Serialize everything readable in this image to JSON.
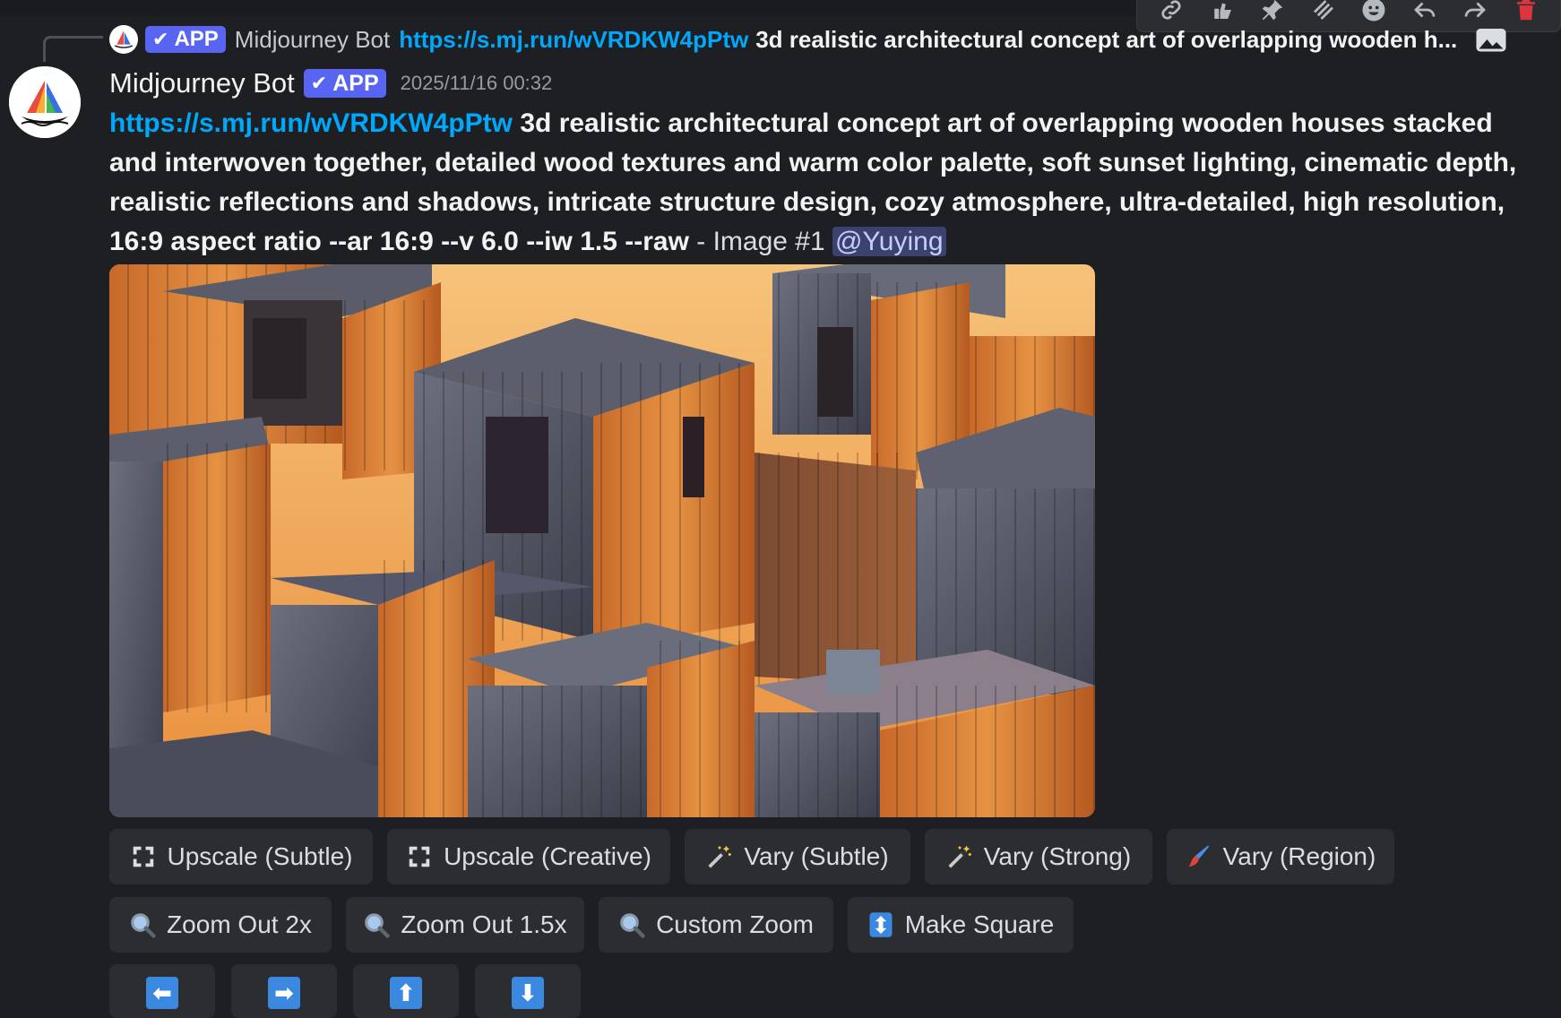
{
  "reply": {
    "badge": "APP",
    "author": "Midjourney Bot",
    "link": "https://s.mj.run/wVRDKW4pPtw",
    "text": "3d realistic architectural concept art of overlapping wooden h..."
  },
  "message": {
    "author": "Midjourney Bot",
    "badge": "APP",
    "timestamp": "2025/11/16 00:32",
    "link": "https://s.mj.run/wVRDKW4pPtw",
    "prompt": "3d realistic architectural concept art of overlapping wooden houses stacked and interwoven together, detailed wood textures and warm color palette, soft sunset lighting, cinematic depth, realistic reflections and shadows, intricate structure design, cozy atmosphere, ultra-detailed, high resolution, 16:9 aspect ratio --ar 16:9 --v 6.0 --iw 1.5 --raw",
    "suffix": " - Image #1 ",
    "mention": "@Yuying"
  },
  "toolbar_icons": [
    "link-icon",
    "react-icon",
    "pin-icon",
    "thread-icon",
    "emoji-icon",
    "reply-icon",
    "forward-icon",
    "delete-icon"
  ],
  "buttons_row1": [
    {
      "label": "Upscale (Subtle)",
      "icon": "expand-icon"
    },
    {
      "label": "Upscale (Creative)",
      "icon": "expand-icon"
    },
    {
      "label": "Vary (Subtle)",
      "icon": "magic-wand-icon"
    },
    {
      "label": "Vary (Strong)",
      "icon": "magic-wand-icon"
    },
    {
      "label": "Vary (Region)",
      "icon": "paintbrush-icon"
    }
  ],
  "buttons_row2": [
    {
      "label": "Zoom Out 2x",
      "icon": "magnifier-icon"
    },
    {
      "label": "Zoom Out 1.5x",
      "icon": "magnifier-icon"
    },
    {
      "label": "Custom Zoom",
      "icon": "magnifier-icon"
    },
    {
      "label": "Make Square",
      "icon": "up-down-arrow-icon"
    }
  ],
  "pan_buttons": [
    {
      "glyph": "⬅",
      "icon": "arrow-left-icon"
    },
    {
      "glyph": "➡",
      "icon": "arrow-right-icon"
    },
    {
      "glyph": "⬆",
      "icon": "arrow-up-icon"
    },
    {
      "glyph": "⬇",
      "icon": "arrow-down-icon"
    }
  ],
  "colors": {
    "accent": "#5865f2",
    "link": "#00a8fc",
    "danger": "#da373c",
    "background": "#1e1f22",
    "button": "#2b2d31"
  }
}
